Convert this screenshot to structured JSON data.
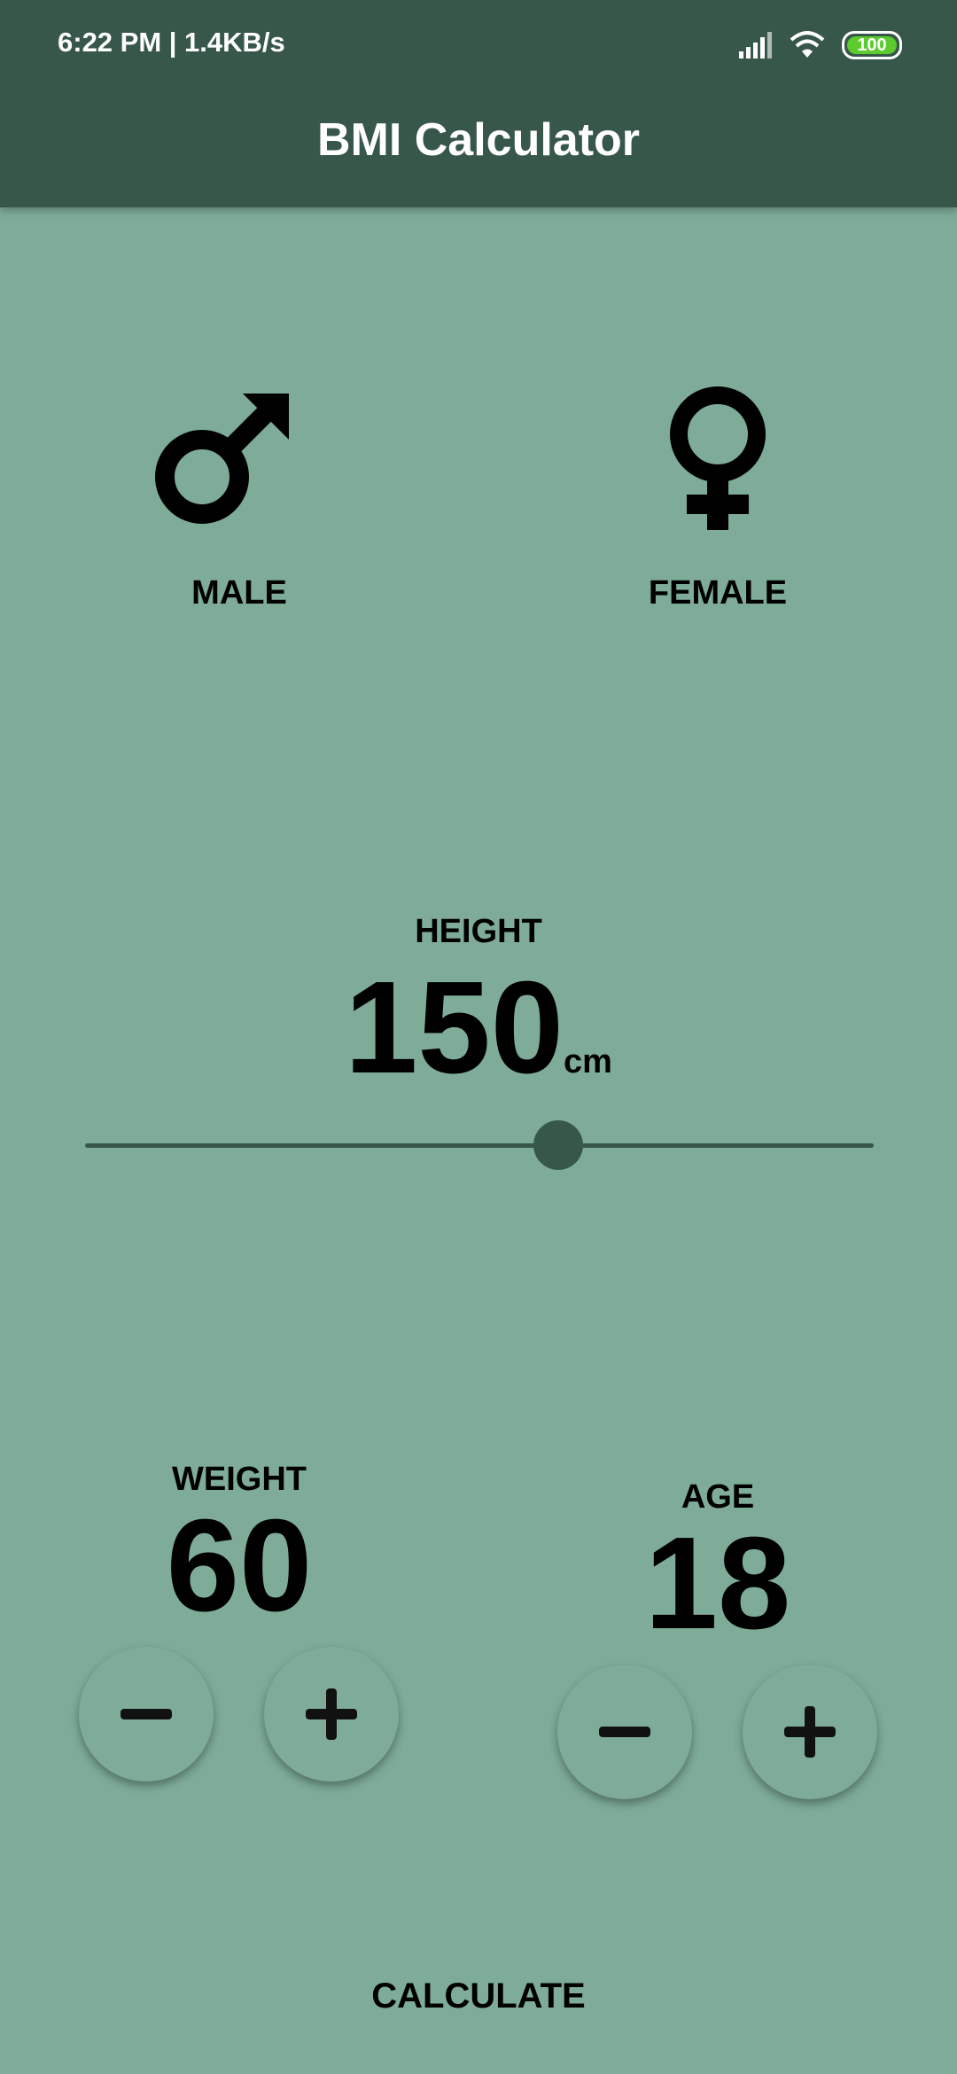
{
  "status_bar": {
    "time": "6:22 PM | 1.4KB/s",
    "battery": "100"
  },
  "app_bar": {
    "title": "BMI Calculator"
  },
  "gender": {
    "male_label": "MALE",
    "female_label": "FEMALE"
  },
  "height": {
    "label": "HEIGHT",
    "value": "150",
    "unit": "cm",
    "slider_fraction": 0.6
  },
  "weight": {
    "label": "WEIGHT",
    "value": "60"
  },
  "age": {
    "label": "AGE",
    "value": "18"
  },
  "calculate_label": "CALCULATE",
  "colors": {
    "app_bar": "#37574a",
    "background": "#7eac99",
    "accent": "#37574a"
  },
  "icons": {
    "male": "male-icon",
    "female": "female-icon",
    "minus": "minus-icon",
    "plus": "plus-icon"
  }
}
